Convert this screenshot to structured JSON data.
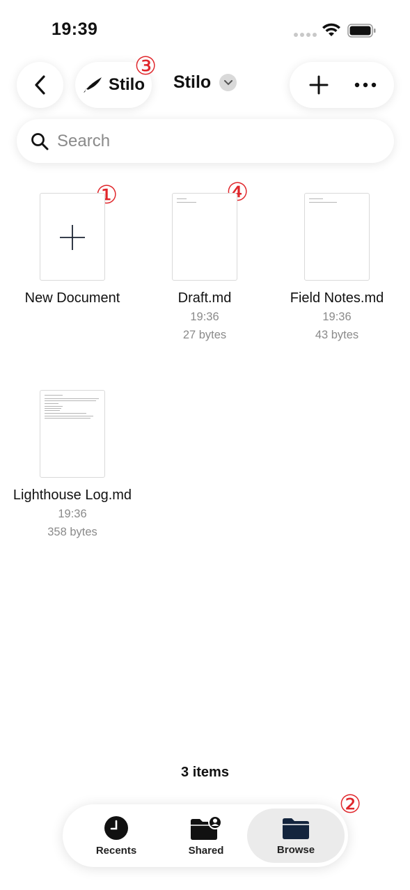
{
  "status": {
    "time": "19:39"
  },
  "nav": {
    "app_label": "Stilo",
    "title": "Stilo"
  },
  "search": {
    "placeholder": "Search"
  },
  "annotations": [
    "①",
    "②",
    "③",
    "④"
  ],
  "items": [
    {
      "name": "New Document",
      "time": "",
      "size": ""
    },
    {
      "name": "Draft.md",
      "time": "19:36",
      "size": "27 bytes"
    },
    {
      "name": "Field Notes.md",
      "time": "19:36",
      "size": "43 bytes"
    },
    {
      "name": "Lighthouse Log.md",
      "time": "19:36",
      "size": "358 bytes"
    }
  ],
  "footer": {
    "count": "3 items"
  },
  "tabs": [
    {
      "label": "Recents",
      "icon": "clock-icon"
    },
    {
      "label": "Shared",
      "icon": "shared-folder-icon"
    },
    {
      "label": "Browse",
      "icon": "folder-icon",
      "active": true
    }
  ]
}
